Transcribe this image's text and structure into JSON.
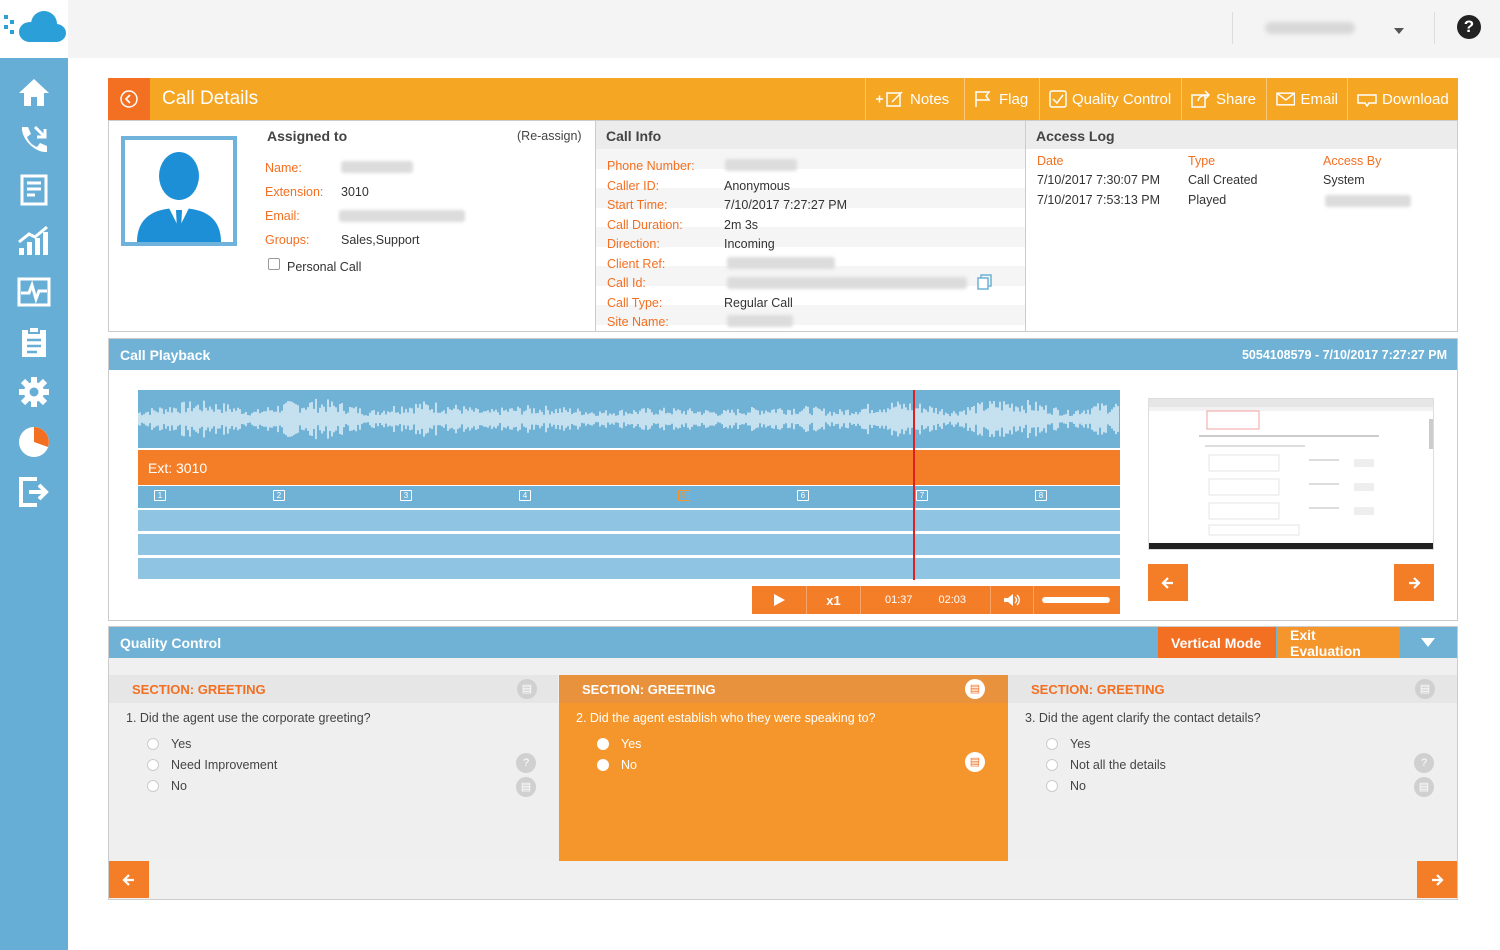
{
  "header": {
    "help_label": "?"
  },
  "call_details": {
    "title": "Call Details",
    "toolbar": {
      "notes": "Notes",
      "flag": "Flag",
      "quality_control": "Quality Control",
      "share": "Share",
      "email": "Email",
      "download": "Download"
    }
  },
  "assigned": {
    "heading": "Assigned to",
    "reassign": "(Re-assign)",
    "name_label": "Name:",
    "extension_label": "Extension:",
    "extension_value": "3010",
    "email_label": "Email:",
    "groups_label": "Groups:",
    "groups_value": "Sales,Support",
    "personal_call_label": "Personal Call"
  },
  "call_info": {
    "heading": "Call Info",
    "rows": [
      {
        "label": "Phone Number:",
        "value": ""
      },
      {
        "label": "Caller ID:",
        "value": "Anonymous"
      },
      {
        "label": "Start Time:",
        "value": "7/10/2017 7:27:27 PM"
      },
      {
        "label": "Call Duration:",
        "value": "2m 3s"
      },
      {
        "label": "Direction:",
        "value": "Incoming"
      },
      {
        "label": "Client Ref:",
        "value": ""
      },
      {
        "label": "Call Id:",
        "value": ""
      },
      {
        "label": "Call Type:",
        "value": "Regular Call"
      },
      {
        "label": "Site Name:",
        "value": ""
      }
    ]
  },
  "access_log": {
    "heading": "Access Log",
    "columns": [
      "Date",
      "Type",
      "Access By"
    ],
    "rows": [
      [
        "7/10/2017 7:30:07 PM",
        "Call Created",
        "System"
      ],
      [
        "7/10/2017 7:53:13 PM",
        "Played",
        ""
      ]
    ]
  },
  "playback": {
    "title": "Call Playback",
    "meta": "5054108579 - 7/10/2017 7:27:27 PM",
    "track_label": "Ext: 3010",
    "markers": [
      "1",
      "2",
      "3",
      "4",
      "5",
      "6",
      "7",
      "8"
    ],
    "active_marker": "5",
    "current_time": "01:37",
    "total_time": "02:03",
    "speed": "x1",
    "progress_fraction": 0.79,
    "volume_fraction": 1.0
  },
  "quality_control": {
    "title": "Quality Control",
    "vertical_mode": "Vertical Mode",
    "exit_evaluation": "Exit Evaluation",
    "cards": [
      {
        "section": "SECTION: GREETING",
        "question": "1. Did the agent use the corporate greeting?",
        "options": [
          "Yes",
          "Need Improvement",
          "No"
        ],
        "active": false
      },
      {
        "section": "SECTION: GREETING",
        "question": "2. Did the agent establish who they were speaking to?",
        "options": [
          "Yes",
          "No"
        ],
        "active": true
      },
      {
        "section": "SECTION: GREETING",
        "question": "3. Did the agent clarify the contact details?",
        "options": [
          "Yes",
          "Not all the details",
          "No"
        ],
        "active": false
      }
    ]
  },
  "colors": {
    "orange": "#f5a623",
    "deep_orange": "#f36f21",
    "blue": "#6fb2d6",
    "sidebar": "#67aed6"
  }
}
